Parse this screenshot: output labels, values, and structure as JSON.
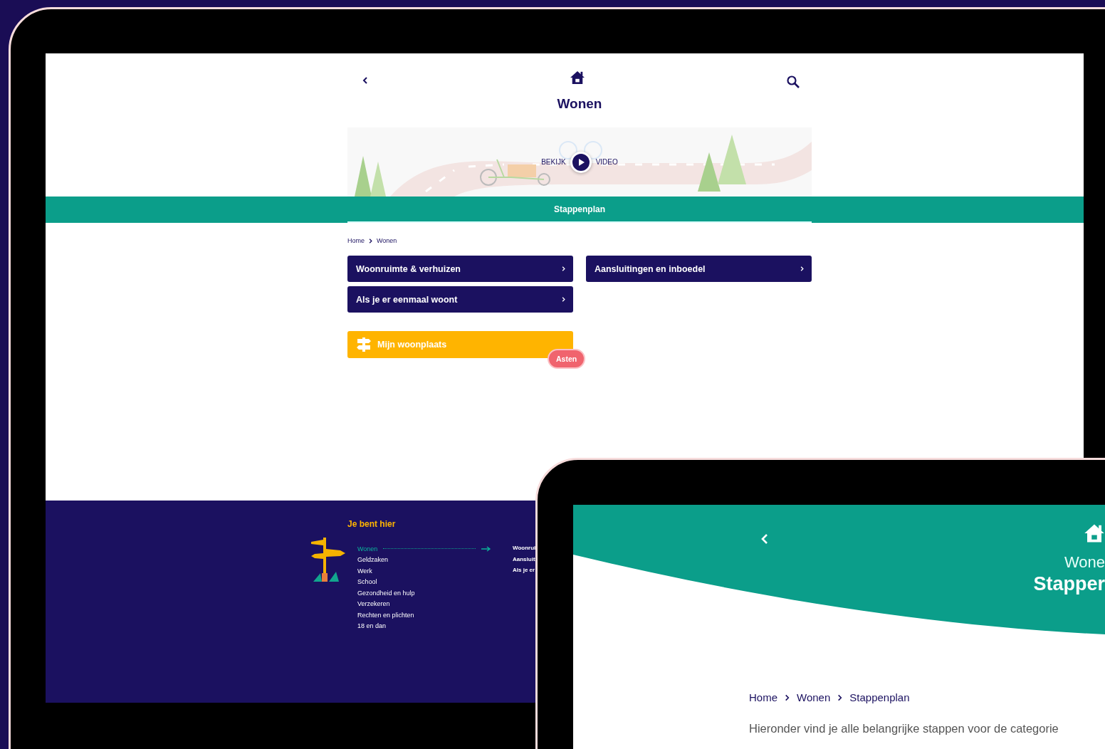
{
  "screen_main": {
    "header": {
      "title": "Wonen"
    },
    "video_banner": {
      "label_left": "BEKIJK",
      "label_right": "VIDEO"
    },
    "section_bar": {
      "label": "Stappenplan"
    },
    "breadcrumb": [
      "Home",
      "Wonen"
    ],
    "categories": [
      {
        "label": "Woonruimte & verhuizen"
      },
      {
        "label": "Aansluitingen en inboedel"
      },
      {
        "label": "Als je er eenmaal woont"
      }
    ],
    "place_button": {
      "label": "Mijn woonplaats",
      "badge": "Asten"
    },
    "footer": {
      "heading": "Je bent hier",
      "items": [
        {
          "label": "Wonen",
          "selected": true
        },
        {
          "label": "Geldzaken",
          "selected": false
        },
        {
          "label": "Werk",
          "selected": false
        },
        {
          "label": "School",
          "selected": false
        },
        {
          "label": "Gezondheid en hulp",
          "selected": false
        },
        {
          "label": "Verzekeren",
          "selected": false
        },
        {
          "label": "Rechten en plichten",
          "selected": false
        },
        {
          "label": "18 en dan",
          "selected": false
        }
      ],
      "sub_items": [
        "Woonrui",
        "Aansluit",
        "Als je er"
      ]
    }
  },
  "screen_detail": {
    "header": {
      "subtitle": "Wone",
      "title": "Stapper"
    },
    "breadcrumb": [
      "Home",
      "Wonen",
      "Stappenplan"
    ],
    "intro": "Hieronder vind je alle belangrijke stappen voor de categorie"
  }
}
